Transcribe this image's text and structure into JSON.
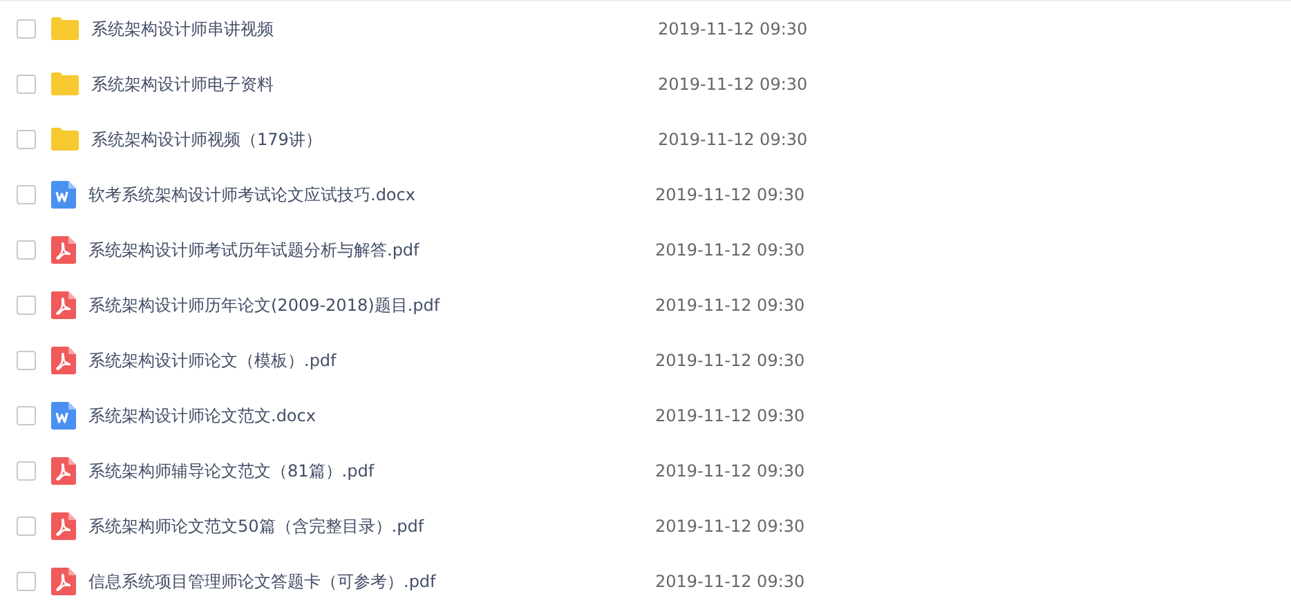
{
  "files": [
    {
      "kind": "folder",
      "name": "系统架构设计师串讲视频",
      "date": "2019-11-12 09:30",
      "checked": false
    },
    {
      "kind": "folder",
      "name": "系统架构设计师电子资料",
      "date": "2019-11-12 09:30",
      "checked": false
    },
    {
      "kind": "folder",
      "name": "系统架构设计师视频（179讲）",
      "date": "2019-11-12 09:30",
      "checked": false
    },
    {
      "kind": "docx",
      "name": "软考系统架构设计师考试论文应试技巧.docx",
      "date": "2019-11-12 09:30",
      "checked": false
    },
    {
      "kind": "pdf",
      "name": "系统架构设计师考试历年试题分析与解答.pdf",
      "date": "2019-11-12 09:30",
      "checked": false
    },
    {
      "kind": "pdf",
      "name": "系统架构设计师历年论文(2009-2018)题目.pdf",
      "date": "2019-11-12 09:30",
      "checked": false
    },
    {
      "kind": "pdf",
      "name": "系统架构设计师论文（模板）.pdf",
      "date": "2019-11-12 09:30",
      "checked": false
    },
    {
      "kind": "docx",
      "name": "系统架构设计师论文范文.docx",
      "date": "2019-11-12 09:30",
      "checked": false
    },
    {
      "kind": "pdf",
      "name": "系统架构师辅导论文范文（81篇）.pdf",
      "date": "2019-11-12 09:30",
      "checked": false
    },
    {
      "kind": "pdf",
      "name": "系统架构师论文范文50篇（含完整目录）.pdf",
      "date": "2019-11-12 09:30",
      "checked": false
    },
    {
      "kind": "pdf",
      "name": "信息系统项目管理师论文答题卡（可参考）.pdf",
      "date": "2019-11-12 09:30",
      "checked": false
    }
  ]
}
